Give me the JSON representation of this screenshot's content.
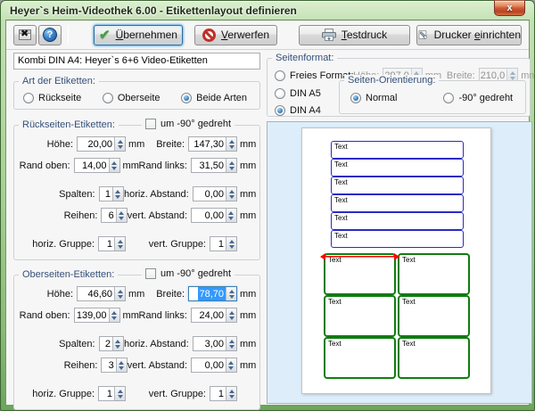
{
  "window": {
    "title": "Heyer`s Heim-Videothek 6.00 - Etikettenlayout definieren",
    "close_glyph": "x"
  },
  "toolbar": {
    "exit_icon": "exit-window-icon",
    "help_icon": "help-icon",
    "apply": {
      "icon": "check-icon",
      "u": "Ü",
      "rest": "bernehmen"
    },
    "discard": {
      "icon": "no-entry-icon",
      "u": "V",
      "rest": "erwerfen"
    },
    "testprint": {
      "icon": "printer-icon",
      "u": "T",
      "rest": "estdruck"
    },
    "setup": {
      "icon": "printer-wrench-icon",
      "pre": "Drucker ",
      "u": "e",
      "rest": "inrichten"
    }
  },
  "units": {
    "mm": "mm"
  },
  "labels": {
    "hoehe": "Höhe:",
    "breite": "Breite:",
    "rand_oben": "Rand oben:",
    "rand_links": "Rand links:",
    "spalten": "Spalten:",
    "h_abstand": "horiz. Abstand:",
    "reihen": "Reihen:",
    "v_abstand": "vert. Abstand:",
    "h_gruppe": "horiz. Gruppe:",
    "v_gruppe": "vert. Gruppe:",
    "rotate": "um -90° gedreht"
  },
  "left": {
    "layout_name": "Kombi DIN A4: Heyer`s 6+6 Video-Etiketten",
    "art": {
      "caption": "Art der Etiketten:",
      "back": "Rückseite",
      "top": "Oberseite",
      "both": "Beide Arten",
      "selected": "Beide Arten"
    },
    "back": {
      "caption": "Rückseiten-Etiketten:",
      "rotated": false,
      "hoehe": "20,00",
      "breite": "147,30",
      "rand_oben": "14,00",
      "rand_links": "31,50",
      "spalten": "1",
      "h_abstand": "0,00",
      "reihen": "6",
      "v_abstand": "0,00",
      "h_gruppe": "1",
      "v_gruppe": "1"
    },
    "top": {
      "caption": "Oberseiten-Etiketten:",
      "rotated": false,
      "hoehe": "46,60",
      "breite": "78,70",
      "breite_state": "text selected / field focused",
      "rand_oben": "139,00",
      "rand_links": "24,00",
      "spalten": "2",
      "h_abstand": "3,00",
      "reihen": "3",
      "v_abstand": "0,00",
      "h_gruppe": "1",
      "v_gruppe": "1"
    }
  },
  "right": {
    "format": {
      "caption": "Seitenformat:",
      "free": "Freies Format:",
      "a5": "DIN A5",
      "a4": "DIN A4",
      "selected": "DIN A4",
      "hoehe": "297,0",
      "breite": "210,0",
      "orientation": {
        "caption": "Seiten-Orientierung:",
        "normal": "Normal",
        "rotated": "-90° gedreht",
        "selected": "Normal"
      }
    },
    "preview": {
      "label_text": "Text",
      "back_label_count": 6,
      "top_label_grid": "2 x 3",
      "colors": {
        "back_label_border": "#2a2ac4",
        "top_label_border": "#117c11",
        "dimension_arrow": "#ff0000",
        "page": "#ffffff",
        "area_background": "#ddeefa"
      }
    }
  },
  "colors": {
    "frame_green": "#8aba77",
    "focus_blue": "#3c7fb1",
    "selection_blue": "#3399ff",
    "group_caption": "#35507a"
  }
}
